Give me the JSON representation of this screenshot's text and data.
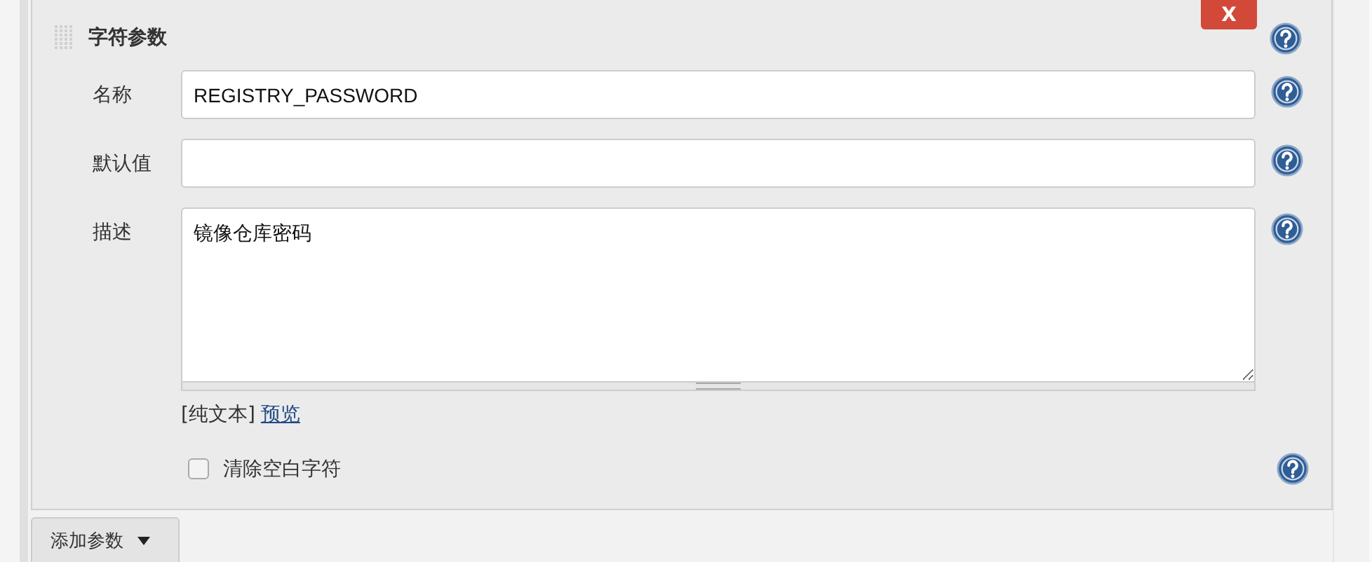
{
  "section": {
    "title": "字符参数",
    "delete_button": "X"
  },
  "fields": [
    {
      "kind": "input",
      "label": "名称",
      "value": "REGISTRY_PASSWORD"
    },
    {
      "kind": "input",
      "label": "默认值"
    },
    {
      "kind": "textarea",
      "label": "描述",
      "value": "镜像仓库密码"
    }
  ],
  "format": {
    "plain": "[纯文本]",
    "preview": "预览"
  },
  "trim_option": {
    "label": "清除空白字符",
    "checked": false
  },
  "add_button": {
    "label": "添加参数"
  }
}
